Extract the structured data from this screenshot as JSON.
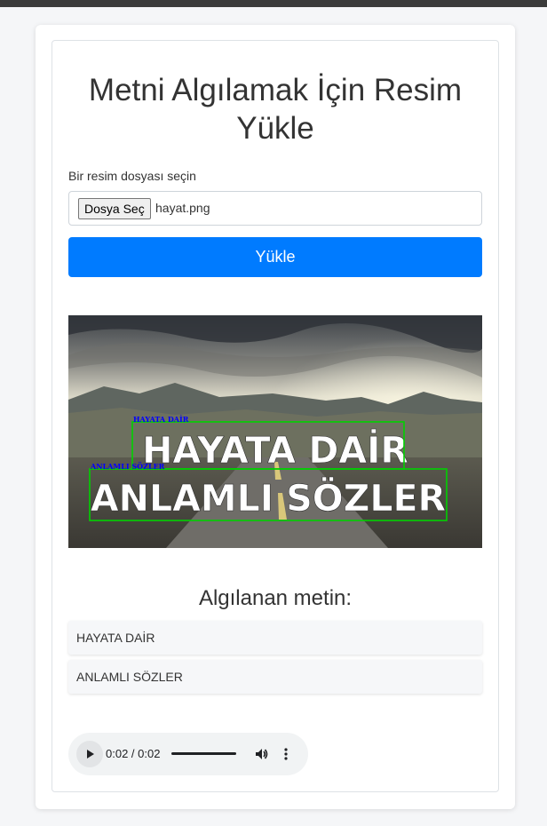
{
  "page": {
    "title": "Metni Algılamak İçin Resim Yükle"
  },
  "form": {
    "file_label": "Bir resim dosyası seçin",
    "choose_button": "Dosya Seç",
    "file_name": "hayat.png",
    "upload_button": "Yükle"
  },
  "image": {
    "overlay_lines": [
      "HAYATA DAİR",
      "ANLAMLI SÖZLER"
    ],
    "box_labels": [
      "HAYATA DAİR",
      "ANLAMLI SÖZLER"
    ],
    "box_color": "#00d100",
    "label_color": "#0000ff"
  },
  "results": {
    "heading": "Algılanan metin:",
    "items": [
      "HAYATA DAİR",
      "ANLAMLI SÖZLER"
    ]
  },
  "audio": {
    "time": "0:02 / 0:02",
    "progress": 1.0
  },
  "colors": {
    "primary": "#007bff",
    "background": "#f5f6f8"
  }
}
